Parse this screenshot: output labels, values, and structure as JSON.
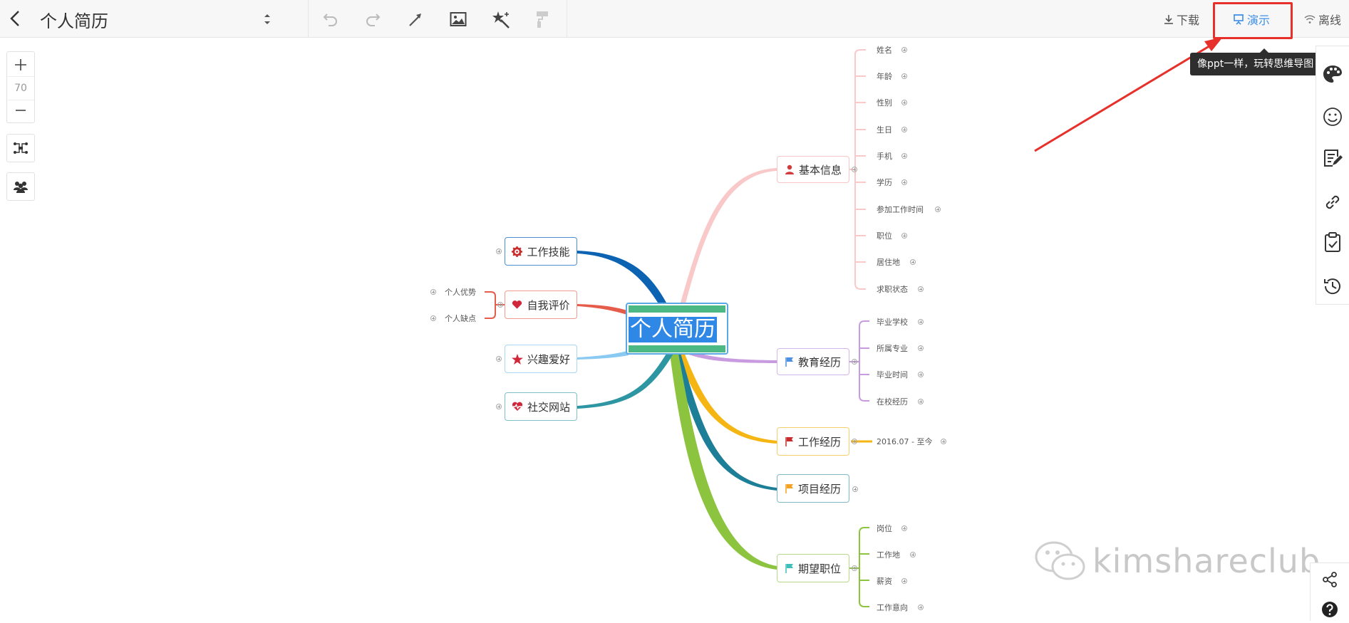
{
  "header": {
    "title": "个人简历",
    "download_label": "下载",
    "present_label": "演示",
    "offline_label": "离线",
    "tooltip": "像ppt一样，玩转思维导图"
  },
  "zoom": {
    "value": "70"
  },
  "mindmap": {
    "central": "个人简历",
    "right_branches": [
      {
        "label": "基本信息",
        "color": "#f7c6c6",
        "leaves": [
          "姓名",
          "年龄",
          "性别",
          "生日",
          "手机",
          "学历",
          "参加工作时间",
          "职位",
          "居住地",
          "求职状态"
        ]
      },
      {
        "label": "教育经历",
        "color": "#c89be0",
        "leaves": [
          "毕业学校",
          "所属专业",
          "毕业时间",
          "在校经历"
        ]
      },
      {
        "label": "工作经历",
        "color": "#f5b614",
        "leaves": [
          "2016.07 - 至今"
        ]
      },
      {
        "label": "项目经历",
        "color": "#1c7e97",
        "leaves": []
      },
      {
        "label": "期望职位",
        "color": "#8cc43f",
        "leaves": [
          "岗位",
          "工作地",
          "薪资",
          "工作意向"
        ]
      }
    ],
    "left_branches": [
      {
        "label": "工作技能",
        "color": "#0b63b1",
        "leaves": []
      },
      {
        "label": "自我评价",
        "color": "#e65c4a",
        "leaves": [
          "个人优势",
          "个人缺点"
        ]
      },
      {
        "label": "兴趣爱好",
        "color": "#8ac9f2",
        "leaves": []
      },
      {
        "label": "社交网站",
        "color": "#2e95a3",
        "leaves": []
      }
    ]
  },
  "watermark": {
    "text": "kimshareclub"
  }
}
